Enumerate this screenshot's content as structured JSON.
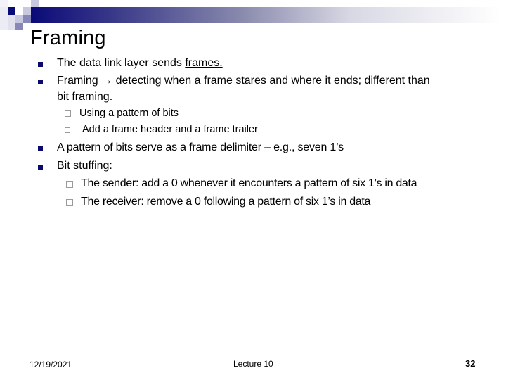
{
  "slide": {
    "title": "Framing",
    "bullets": [
      {
        "prefix": "The data link layer sends ",
        "underlined": "frames.",
        "suffix": ""
      },
      {
        "line1": "Framing → detecting when a frame stares and where it ends; different than",
        "line2": "bit framing."
      },
      {
        "text": "A pattern of bits serve as a frame delimiter – e.g., seven 1’s"
      },
      {
        "text": "Bit stuffing:"
      }
    ],
    "sub_bullets_framing": [
      "Using a pattern of bits",
      "Add a frame header and a frame trailer"
    ],
    "sub_bullets_stuffing": [
      "The sender: add a 0 whenever it encounters a pattern of six 1’s in data",
      "The receiver: remove a 0 following a pattern of six 1’s in data"
    ]
  },
  "footer": {
    "date": "12/19/2021",
    "center": "Lecture 10",
    "page_number": "32"
  },
  "colors": {
    "accent": "#0a0a6e",
    "sub_bullet_border": "#9a9a9a"
  }
}
